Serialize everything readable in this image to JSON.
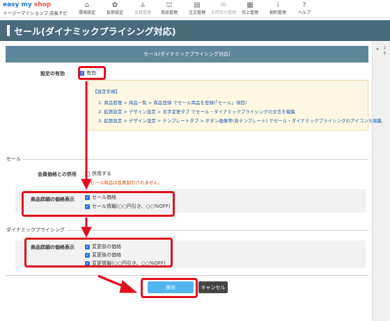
{
  "brand": {
    "logo_part1": "easy my ",
    "logo_part2": "shop",
    "subtitle": "イージーマイショップ 店長ナビ"
  },
  "nav": [
    {
      "label": "環境設定",
      "icon": "⌂"
    },
    {
      "label": "拡張設定",
      "icon": "✿"
    },
    {
      "label": "会員管理",
      "icon": "♟"
    },
    {
      "label": "商品管理",
      "icon": "⛫"
    },
    {
      "label": "注文管理",
      "icon": "▤"
    },
    {
      "label": "お問合せ管理",
      "icon": "✉"
    },
    {
      "label": "売上管理",
      "icon": "▦"
    },
    {
      "label": "契約管理",
      "icon": "i"
    },
    {
      "label": "ヘルプ",
      "icon": "?"
    }
  ],
  "page_title": "セール(ダイナミックプライシング対応)",
  "section_header": "セール(ダイナミックプライシング対応)",
  "setting_enable": {
    "label": "設定の有効",
    "checkbox": "有効",
    "checked": true
  },
  "steps": {
    "head": "【設定手順】",
    "items": [
      "1. 商品管理 > 商品一覧 > 商品登録 でセール商品を登録(「セール」項目)",
      "2. 拡張設定 > デザイン設定 > 文字変更タブ でセール・ダイナミックプライシングの文言を編集",
      "3. 拡張設定 > デザイン設定 > テンプレートタブ > ボタン画像等(各テンプレート) でセール・ダイナミックプライシングのアイコンを編集"
    ]
  },
  "sale": {
    "group_title": "セール",
    "member_price": {
      "label": "会員価格との併用",
      "checkbox": "併用する",
      "checked": false,
      "note": "※セール商品は会員割引されません。"
    },
    "detail_display": {
      "label": "商品詳細の価格表示",
      "options": [
        {
          "text": "セール価格",
          "checked": true
        },
        {
          "text": "セール情報(○○円引き、○○%OFF)",
          "checked": true
        }
      ]
    }
  },
  "dynamic": {
    "group_title": "ダイナミックプライシング",
    "detail_display": {
      "label": "商品詳細の価格表示",
      "options": [
        {
          "text": "変更前の価格",
          "checked": true
        },
        {
          "text": "変更後の価格",
          "checked": true
        },
        {
          "text": "変更情報(○○円引き、○○%OFF)",
          "checked": true
        }
      ]
    }
  },
  "buttons": {
    "save": "保存",
    "cancel": "キャンセル"
  },
  "right_strip": {
    "text_1": "ｽ",
    "text_2": "ｻ"
  },
  "colors": {
    "title_bar": "#4a6b7c",
    "section_header": "#5f879b",
    "highlight": "#e0101f",
    "save": "#52b5f0"
  }
}
